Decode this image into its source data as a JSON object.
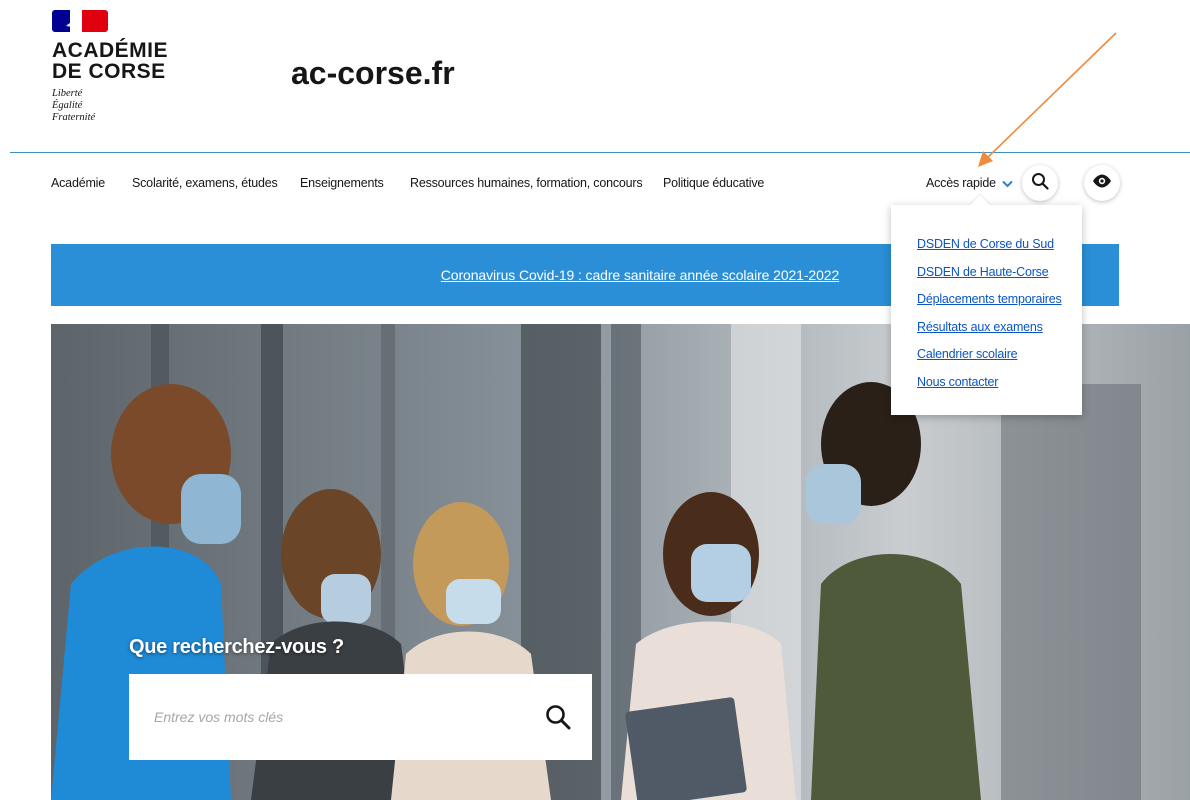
{
  "header": {
    "institution_line1": "ACADÉMIE",
    "institution_line2": "DE CORSE",
    "motto_line1": "Liberté",
    "motto_line2": "Égalité",
    "motto_line3": "Fraternité",
    "site_title": "ac-corse.fr"
  },
  "nav": {
    "items": [
      {
        "label": "Académie"
      },
      {
        "label": "Scolarité, examens, études"
      },
      {
        "label": "Enseignements"
      },
      {
        "label": "Ressources humaines, formation, concours"
      },
      {
        "label": "Politique éducative"
      }
    ],
    "quick_access_label": "Accès rapide",
    "search_icon": "search-icon",
    "accessibility_icon": "eye-icon"
  },
  "banner": {
    "link_text": "Coronavirus Covid-19 : cadre sanitaire année scolaire 2021-2022"
  },
  "quick_access_menu": {
    "items": [
      {
        "label": "DSDEN de Corse du Sud"
      },
      {
        "label": "DSDEN de Haute-Corse"
      },
      {
        "label": "Déplacements temporaires"
      },
      {
        "label": "Résultats aux examens"
      },
      {
        "label": "Calendrier scolaire"
      },
      {
        "label": "Nous contacter"
      }
    ]
  },
  "hero": {
    "title": "Que recherchez-vous ?",
    "search_placeholder": "Entrez vos mots clés"
  },
  "colors": {
    "banner_blue": "#2a8fd6",
    "link_blue": "#0a55c4",
    "header_line": "#3f8fc1",
    "annotation_arrow": "#f08a3c",
    "flag_blue": "#000091",
    "flag_red": "#e1000f"
  }
}
